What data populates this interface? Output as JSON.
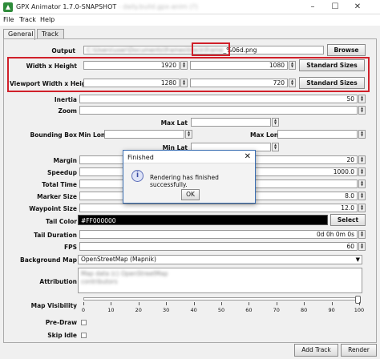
{
  "window": {
    "title": "GPX Animator 1.7.0-SNAPSHOT",
    "title_blurred": "- daily.build.gpx-anim (?)",
    "min_icon": "minimize-icon",
    "max_icon": "maximize-icon",
    "close_icon": "close-icon"
  },
  "menu": [
    "File",
    "Track",
    "Help"
  ],
  "tabs": [
    "General",
    "Track"
  ],
  "fields": {
    "output_label": "Output",
    "output_value_blurred": "C:\\Users\\user\\Documents\\frames\\track\\frame",
    "output_value_visible": "_%06d.png",
    "browse_label": "Browse",
    "width_height_label": "Width x Height",
    "width": "1920",
    "height": "1080",
    "standard_sizes_label": "Standard Sizes",
    "viewport_label": "Viewport Width x Height",
    "viewport_width": "1280",
    "viewport_height": "720",
    "inertia_label": "Inertia",
    "inertia": "50",
    "zoom_label": "Zoom",
    "max_lat_label": "Max Lat",
    "bounding_box_label": "Bounding Box",
    "min_lon_label": "Min Lon",
    "max_lon_label": "Max Lon",
    "min_lat_label": "Min Lat",
    "margin_label": "Margin",
    "margin": "20",
    "speedup_label": "Speedup",
    "speedup": "1000.0",
    "total_time_label": "Total Time",
    "marker_size_label": "Marker Size",
    "marker_size": "8.0",
    "waypoint_size_label": "Waypoint Size",
    "waypoint_size": "12.0",
    "tail_color_label": "Tail Color",
    "tail_color": "#FF000000",
    "select_label": "Select",
    "tail_duration_label": "Tail Duration",
    "tail_duration": "0d 0h 0m 0s",
    "fps_label": "FPS",
    "fps": "60",
    "background_map_label": "Background Map",
    "background_map": "OpenStreetMap (Mapnik)",
    "attribution_label": "Attribution",
    "attribution_line1_blurred": "Map data (c) OpenStreetMap",
    "attribution_line2_blurred": "contributors",
    "map_visibility_label": "Map Visibility",
    "map_visibility": 100,
    "slider_ticks": [
      "0",
      "10",
      "20",
      "30",
      "40",
      "50",
      "60",
      "70",
      "80",
      "90",
      "100"
    ],
    "pre_draw_label": "Pre-Draw",
    "skip_idle_label": "Skip Idle"
  },
  "buttons": {
    "add_track": "Add Track",
    "render": "Render"
  },
  "dialog": {
    "title": "Finished",
    "message": "Rendering has finished successfully.",
    "ok": "OK",
    "icon": "info-icon"
  }
}
